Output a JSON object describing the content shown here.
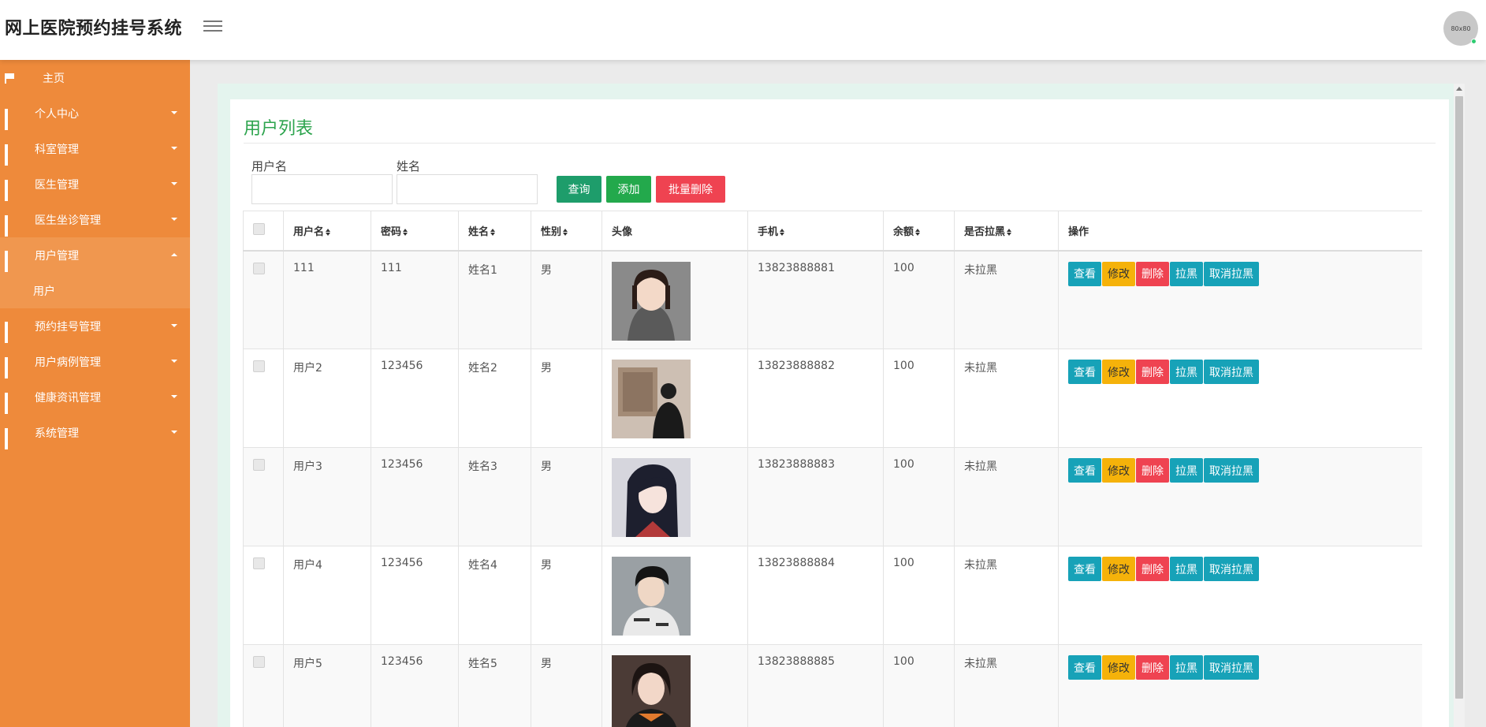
{
  "header": {
    "title": "网上医院预约挂号系统",
    "avatar_text": "80x80"
  },
  "sidebar": {
    "home": "主页",
    "items": [
      {
        "label": "个人中心"
      },
      {
        "label": "科室管理"
      },
      {
        "label": "医生管理"
      },
      {
        "label": "医生坐诊管理"
      },
      {
        "label": "用户管理"
      },
      {
        "label": "预约挂号管理"
      },
      {
        "label": "用户病例管理"
      },
      {
        "label": "健康资讯管理"
      },
      {
        "label": "系统管理"
      }
    ],
    "sub_user": "用户"
  },
  "page": {
    "title": "用户列表",
    "filters": {
      "username_label": "用户名",
      "name_label": "姓名",
      "username_value": "",
      "name_value": ""
    },
    "buttons": {
      "query": "查询",
      "add": "添加",
      "batch_delete": "批量删除"
    }
  },
  "table": {
    "columns": [
      "用户名",
      "密码",
      "姓名",
      "性别",
      "头像",
      "手机",
      "余额",
      "是否拉黑",
      "操作"
    ],
    "actions": {
      "view": "查看",
      "edit": "修改",
      "delete": "删除",
      "blacklist": "拉黑",
      "unblacklist": "取消拉黑"
    },
    "rows": [
      {
        "username": "111",
        "password": "111",
        "name": "姓名1",
        "gender": "男",
        "phone": "13823888881",
        "balance": "100",
        "blacklisted": "未拉黑"
      },
      {
        "username": "用户2",
        "password": "123456",
        "name": "姓名2",
        "gender": "男",
        "phone": "13823888882",
        "balance": "100",
        "blacklisted": "未拉黑"
      },
      {
        "username": "用户3",
        "password": "123456",
        "name": "姓名3",
        "gender": "男",
        "phone": "13823888883",
        "balance": "100",
        "blacklisted": "未拉黑"
      },
      {
        "username": "用户4",
        "password": "123456",
        "name": "姓名4",
        "gender": "男",
        "phone": "13823888884",
        "balance": "100",
        "blacklisted": "未拉黑"
      },
      {
        "username": "用户5",
        "password": "123456",
        "name": "姓名5",
        "gender": "男",
        "phone": "13823888885",
        "balance": "100",
        "blacklisted": "未拉黑"
      }
    ]
  },
  "colors": {
    "sidebar": "#ee8a3b",
    "accent_green": "#2da44e",
    "danger": "#ef4351",
    "info": "#17a2b8",
    "warning": "#f5b20a"
  }
}
